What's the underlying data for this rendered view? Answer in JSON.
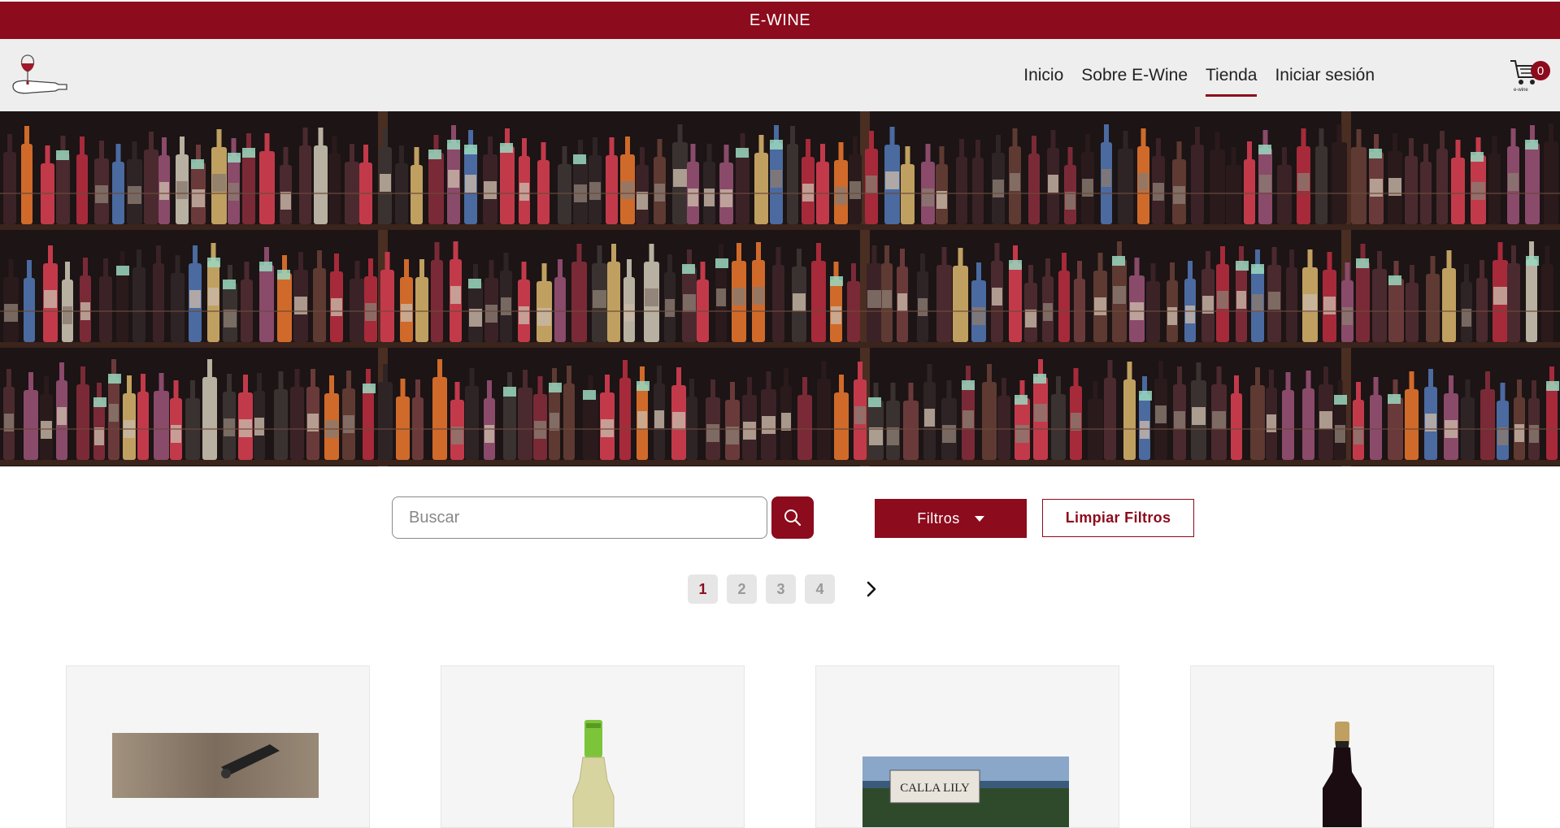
{
  "banner": {
    "title": "E-WINE"
  },
  "nav": {
    "links": [
      {
        "label": "Inicio",
        "active": false
      },
      {
        "label": "Sobre E-Wine",
        "active": false
      },
      {
        "label": "Tienda",
        "active": true
      },
      {
        "label": "Iniciar sesión",
        "active": false
      }
    ],
    "cart": {
      "count": "0",
      "caption": "e-wine",
      "icon": "cart-icon"
    },
    "logo": {
      "icon": "wine-glass-bottle-logo"
    }
  },
  "hero": {
    "image": "wine-shelves-photo"
  },
  "search": {
    "placeholder": "Buscar",
    "value": "",
    "icon": "search-icon"
  },
  "filters": {
    "label": "Filtros",
    "clear_label": "Limpiar Filtros"
  },
  "pagination": {
    "pages": [
      "1",
      "2",
      "3",
      "4"
    ],
    "current": "1",
    "next_icon": "chevron-right-icon"
  },
  "products": [
    {
      "image": "corkscrew-photo"
    },
    {
      "image": "white-wine-bottle"
    },
    {
      "image": "calla-lily-winery-photo",
      "sign_text": "CALLA LILY"
    },
    {
      "image": "red-wine-bottle"
    }
  ],
  "colors": {
    "brand": "#8c0b1c",
    "nav_bg": "#eeeeee",
    "card_bg": "#f5f5f5"
  }
}
